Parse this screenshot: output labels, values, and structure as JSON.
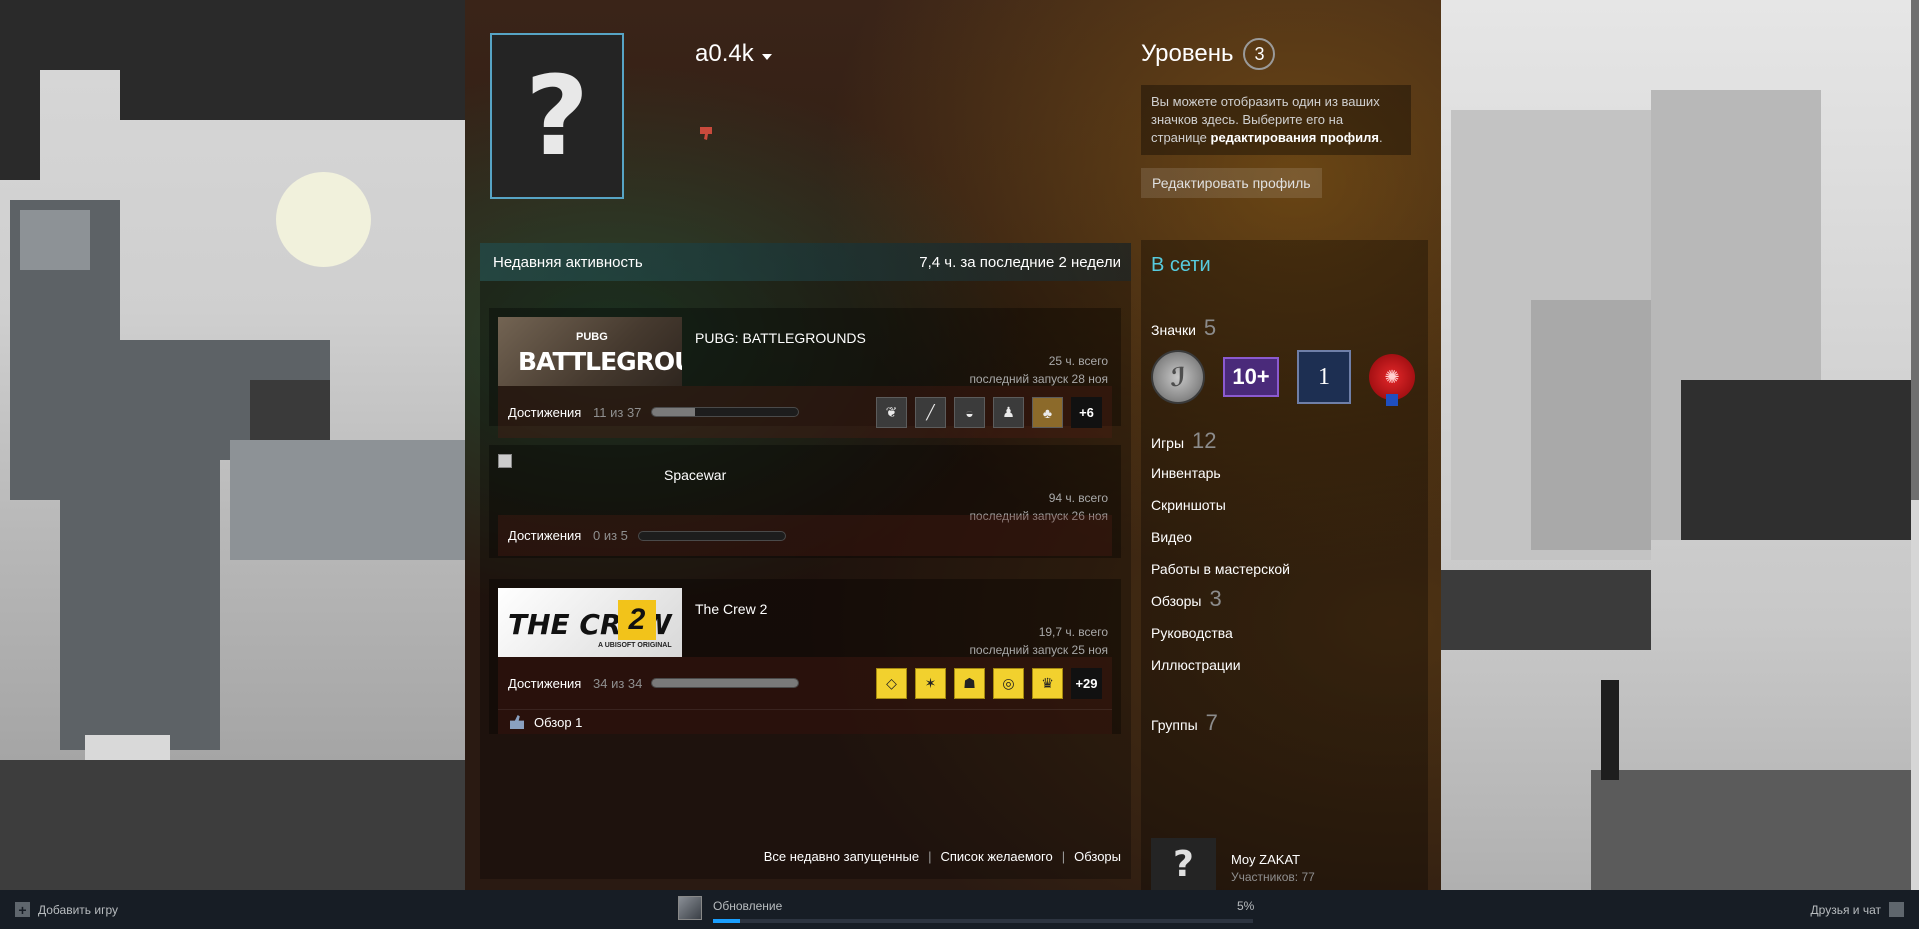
{
  "profile": {
    "persona_name": "a0.4k",
    "avatar_glyph": "?",
    "level_label": "Уровень",
    "level_value": "3",
    "badge_tip": {
      "text_before": "Вы можете отобразить один из ваших значков здесь. Выберите его на странице ",
      "link": "редактирования профиля",
      "text_after": "."
    },
    "edit_profile_label": "Редактировать профиль"
  },
  "activity": {
    "title": "Недавняя активность",
    "summary": "7,4 ч. за последние 2 недели",
    "games": [
      {
        "name": "PUBG: BATTLEGROUNDS",
        "capsule_title": "BATTLEGROUNDS",
        "capsule_sub": "PUBG",
        "hours_total": "25 ч. всего",
        "last_played": "последний запуск 28 ноя",
        "ach_label": "Достижения",
        "ach_count": "11 из 37",
        "ach_progress": 0.2973,
        "ach_more": "+6"
      },
      {
        "name": "Spacewar",
        "hours_total": "94 ч. всего",
        "last_played": "последний запуск 26 ноя",
        "ach_label": "Достижения",
        "ach_count": "0 из 5",
        "ach_progress": 0.0
      },
      {
        "name": "The Crew 2",
        "capsule_title": "THE CREW",
        "capsule_num": "2",
        "capsule_sub": "A UBISOFT ORIGINAL",
        "hours_total": "19,7 ч. всего",
        "last_played": "последний запуск 25 ноя",
        "ach_label": "Достижения",
        "ach_count": "34 из 34",
        "ach_progress": 1.0,
        "ach_more": "+29",
        "review_label": "Обзор 1"
      }
    ],
    "links": {
      "recent": "Все недавно запущенные",
      "wishlist": "Список желаемого",
      "reviews": "Обзоры"
    }
  },
  "sidebar": {
    "status": "В сети",
    "badges_label": "Значки",
    "badges_count": "5",
    "badge_2_text": "10+",
    "badge_3_text": "1",
    "games_label": "Игры",
    "games_count": "12",
    "inventory": "Инвентарь",
    "screenshots": "Скриншоты",
    "videos": "Видео",
    "workshop": "Работы в мастерской",
    "reviews_label": "Обзоры",
    "reviews_count": "3",
    "guides": "Руководства",
    "artwork": "Иллюстрации",
    "groups_label": "Группы",
    "groups_count": "7",
    "group_name": "Moy ZAKAT",
    "group_members": "Участников: 77"
  },
  "bottom_bar": {
    "add_game": "Добавить игру",
    "update_label": "Обновление",
    "update_percent": "5%",
    "update_progress": 0.05,
    "friends_chat": "Друзья и чат"
  },
  "colors": {
    "avatar_border": "#57a4c5",
    "online_status": "#57cbde",
    "bottom_bar_bg": "#171d25",
    "progress_blue": "#1a9fff"
  }
}
